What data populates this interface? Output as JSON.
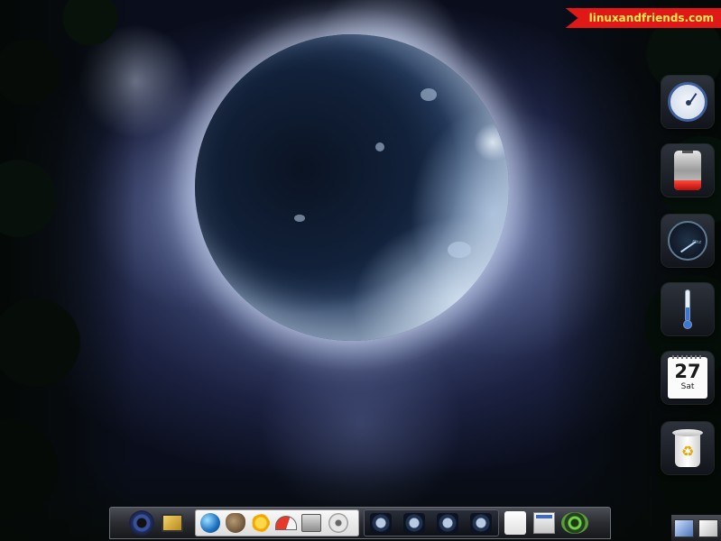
{
  "watermark": {
    "text": "linuxandfriends.com"
  },
  "widgets": {
    "clock": {
      "icon": "analog-clock-icon"
    },
    "battery": {
      "icon": "battery-icon",
      "level": 0.25,
      "color": "#e02020"
    },
    "cpu_gauge": {
      "icon": "cpu-speed-gauge-icon",
      "unit": "Ghz"
    },
    "thermometer": {
      "icon": "thermometer-icon",
      "level": 0.45,
      "color": "#3a78d8"
    },
    "calendar": {
      "icon": "calendar-icon",
      "day": "27",
      "weekday": "Sat"
    },
    "trash": {
      "icon": "recycle-bin-icon"
    }
  },
  "taskbar": {
    "menu_button": "gear-menu-icon",
    "launchers": [
      "show-desktop-icon",
      "firefox-globe-icon",
      "gimp-icon",
      "sun-settings-icon",
      "speedometer-icon",
      "toolbox-icon",
      "disc-icon"
    ],
    "task_count": 4,
    "pager": "workspace-pager",
    "volume": "volume-icon"
  },
  "tray": [
    "network-icon",
    "keyboard-icon"
  ]
}
